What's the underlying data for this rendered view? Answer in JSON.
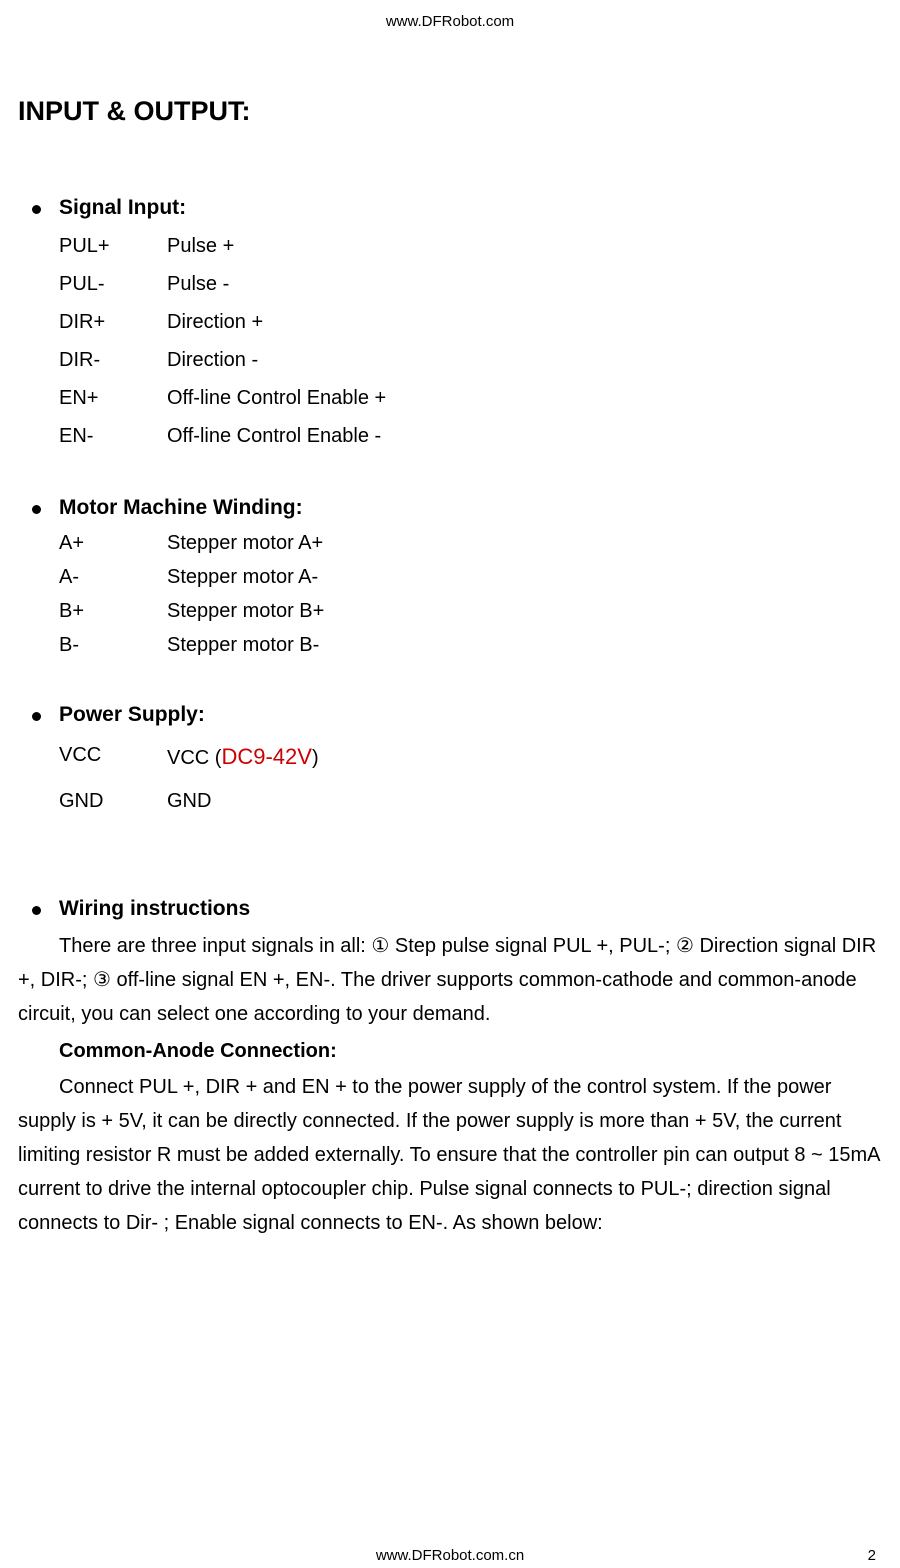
{
  "header": {
    "url": "www.DFRobot.com"
  },
  "title": "INPUT & OUTPUT:",
  "sections": {
    "signal_input": {
      "title": "Signal Input:",
      "pins": [
        {
          "label": "PUL+",
          "desc": "Pulse +"
        },
        {
          "label": "PUL-",
          "desc": "Pulse -"
        },
        {
          "label": "DIR+",
          "desc": "Direction +"
        },
        {
          "label": "DIR-",
          "desc": "Direction -"
        },
        {
          "label": "EN+",
          "desc": "Off-line Control Enable +"
        },
        {
          "label": "EN-",
          "desc": "Off-line Control Enable -"
        }
      ]
    },
    "motor_winding": {
      "title": "Motor Machine Winding:",
      "pins": [
        {
          "label": "A+",
          "desc": "Stepper motor A+"
        },
        {
          "label": "A-",
          "desc": "Stepper motor A-"
        },
        {
          "label": "B+",
          "desc": "Stepper motor B+"
        },
        {
          "label": "B-",
          "desc": "Stepper motor B-"
        }
      ]
    },
    "power_supply": {
      "title": "Power Supply:",
      "pins": [
        {
          "label": "VCC",
          "desc_prefix": "VCC (",
          "desc_highlight": "DC9-42V",
          "desc_suffix": ")"
        },
        {
          "label": "GND",
          "desc": "GND"
        }
      ]
    },
    "wiring": {
      "title": "Wiring instructions",
      "intro": "There are three input signals in all: ① Step pulse signal PUL +, PUL-; ② Direction signal DIR +, DIR-; ③ off-line signal EN +, EN-. The driver supports common-cathode and common-anode circuit, you can select one according to your demand.",
      "sub_title": "Common-Anode Connection:",
      "body": "Connect PUL +, DIR + and EN + to the power supply of the control system. If the power supply is + 5V, it can be directly connected. If the power supply is more than + 5V, the current limiting resistor R must be added externally. To ensure that the controller pin can output 8 ~ 15mA current to drive the internal optocoupler chip. Pulse signal connects to PUL-; direction signal connects to Dir- ; Enable signal connects to EN-. As shown below:"
    }
  },
  "footer": {
    "url": "www.DFRobot.com.cn",
    "page": "2"
  }
}
